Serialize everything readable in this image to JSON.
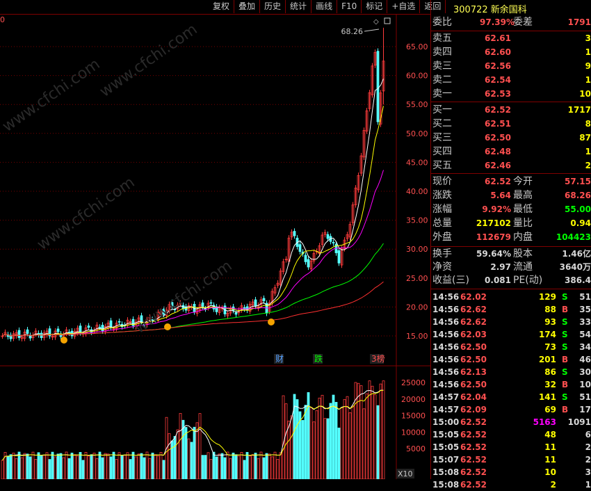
{
  "toolbar": [
    "复权",
    "叠加",
    "历史",
    "统计",
    "画线",
    "F10",
    "标记",
    "+自选",
    "返回"
  ],
  "ticker": "300722 新余国科",
  "chart_data": [
    {
      "type": "candlestick",
      "y_ticks": [
        "65.00",
        "60.00",
        "55.00",
        "50.00",
        "45.00",
        "40.00",
        "35.00",
        "30.00",
        "25.00",
        "20.00",
        "15.00"
      ],
      "high_marker": "68.26",
      "top_left_label": "0",
      "event_markers": [
        {
          "label": "财",
          "color": "#54a0ff"
        },
        {
          "label": "跌",
          "color": "#00ff00"
        },
        {
          "label": "3榜",
          "color": "#ff5050"
        }
      ],
      "ma_colors": [
        "#ffffff",
        "#ffff00",
        "#ff00ff",
        "#00ff00",
        "#ff3030"
      ]
    },
    {
      "type": "bar",
      "title": "volume",
      "y_ticks": [
        "25000",
        "20000",
        "15000",
        "10000",
        "5000"
      ],
      "unit": "X10"
    }
  ],
  "quote": {
    "weibi_label": "委比",
    "weibi": "97.39%",
    "weicha_label": "委差",
    "weicha": "1791",
    "sells": [
      {
        "label": "卖五",
        "price": "62.61",
        "vol": "3"
      },
      {
        "label": "卖四",
        "price": "62.60",
        "vol": "1"
      },
      {
        "label": "卖三",
        "price": "62.56",
        "vol": "9"
      },
      {
        "label": "卖二",
        "price": "62.54",
        "vol": "1"
      },
      {
        "label": "卖一",
        "price": "62.53",
        "vol": "10"
      }
    ],
    "buys": [
      {
        "label": "买一",
        "price": "62.52",
        "vol": "1717"
      },
      {
        "label": "买二",
        "price": "62.51",
        "vol": "8"
      },
      {
        "label": "买三",
        "price": "62.50",
        "vol": "87"
      },
      {
        "label": "买四",
        "price": "62.48",
        "vol": "1"
      },
      {
        "label": "买五",
        "price": "62.46",
        "vol": "2"
      }
    ],
    "stats": [
      {
        "l1": "现价",
        "v1": "62.52",
        "c1": "red",
        "l2": "今开",
        "v2": "57.15",
        "c2": "red"
      },
      {
        "l1": "涨跌",
        "v1": "5.64",
        "c1": "red",
        "l2": "最高",
        "v2": "68.26",
        "c2": "red"
      },
      {
        "l1": "涨幅",
        "v1": "9.92%",
        "c1": "red",
        "l2": "最低",
        "v2": "55.00",
        "c2": "green"
      },
      {
        "l1": "总量",
        "v1": "217102",
        "c1": "yellow",
        "l2": "量比",
        "v2": "0.94",
        "c2": "yellow"
      },
      {
        "l1": "外盘",
        "v1": "112679",
        "c1": "red",
        "l2": "内盘",
        "v2": "104423",
        "c2": "green"
      }
    ],
    "stats2": [
      {
        "l1": "换手",
        "v1": "59.64%",
        "l2": "股本",
        "v2": "1.46亿"
      },
      {
        "l1": "净资",
        "v1": "2.97",
        "l2": "流通",
        "v2": "3640万"
      },
      {
        "l1": "收益(三)",
        "v1": "0.081",
        "l2": "PE(动)",
        "v2": "386.4"
      }
    ],
    "ticks": [
      {
        "t": "14:56",
        "p": "62.02",
        "v": "129",
        "bs": "S",
        "x": "51",
        "pc": "red",
        "vc": "yellow",
        "bc": "green"
      },
      {
        "t": "14:56",
        "p": "62.62",
        "v": "88",
        "bs": "B",
        "x": "35",
        "pc": "red",
        "vc": "yellow",
        "bc": "red"
      },
      {
        "t": "14:56",
        "p": "62.62",
        "v": "93",
        "bs": "S",
        "x": "33",
        "pc": "red",
        "vc": "yellow",
        "bc": "green"
      },
      {
        "t": "14:56",
        "p": "62.03",
        "v": "174",
        "bs": "S",
        "x": "54",
        "pc": "red",
        "vc": "yellow",
        "bc": "green"
      },
      {
        "t": "14:56",
        "p": "62.50",
        "v": "73",
        "bs": "S",
        "x": "34",
        "pc": "red",
        "vc": "yellow",
        "bc": "green"
      },
      {
        "t": "14:56",
        "p": "62.50",
        "v": "201",
        "bs": "B",
        "x": "46",
        "pc": "red",
        "vc": "yellow",
        "bc": "red"
      },
      {
        "t": "14:56",
        "p": "62.13",
        "v": "86",
        "bs": "S",
        "x": "30",
        "pc": "red",
        "vc": "yellow",
        "bc": "green"
      },
      {
        "t": "14:56",
        "p": "62.50",
        "v": "32",
        "bs": "B",
        "x": "10",
        "pc": "red",
        "vc": "yellow",
        "bc": "red"
      },
      {
        "t": "14:57",
        "p": "62.04",
        "v": "141",
        "bs": "S",
        "x": "51",
        "pc": "red",
        "vc": "yellow",
        "bc": "green"
      },
      {
        "t": "14:57",
        "p": "62.09",
        "v": "69",
        "bs": "B",
        "x": "17",
        "pc": "red",
        "vc": "yellow",
        "bc": "red"
      },
      {
        "t": "15:00",
        "p": "62.52",
        "v": "5163",
        "bs": "",
        "x": "1091",
        "pc": "red",
        "vc": "magenta",
        "bc": "white"
      },
      {
        "t": "15:05",
        "p": "62.52",
        "v": "48",
        "bs": "",
        "x": "6",
        "pc": "red",
        "vc": "yellow",
        "bc": "white"
      },
      {
        "t": "15:05",
        "p": "62.52",
        "v": "11",
        "bs": "",
        "x": "2",
        "pc": "red",
        "vc": "yellow",
        "bc": "white"
      },
      {
        "t": "15:07",
        "p": "62.52",
        "v": "11",
        "bs": "",
        "x": "2",
        "pc": "red",
        "vc": "yellow",
        "bc": "white"
      },
      {
        "t": "15:08",
        "p": "62.52",
        "v": "10",
        "bs": "",
        "x": "3",
        "pc": "red",
        "vc": "yellow",
        "bc": "white"
      },
      {
        "t": "15:08",
        "p": "62.52",
        "v": "2",
        "bs": "",
        "x": "1",
        "pc": "red",
        "vc": "yellow",
        "bc": "white"
      }
    ]
  },
  "watermark": "www.cfchi.com"
}
